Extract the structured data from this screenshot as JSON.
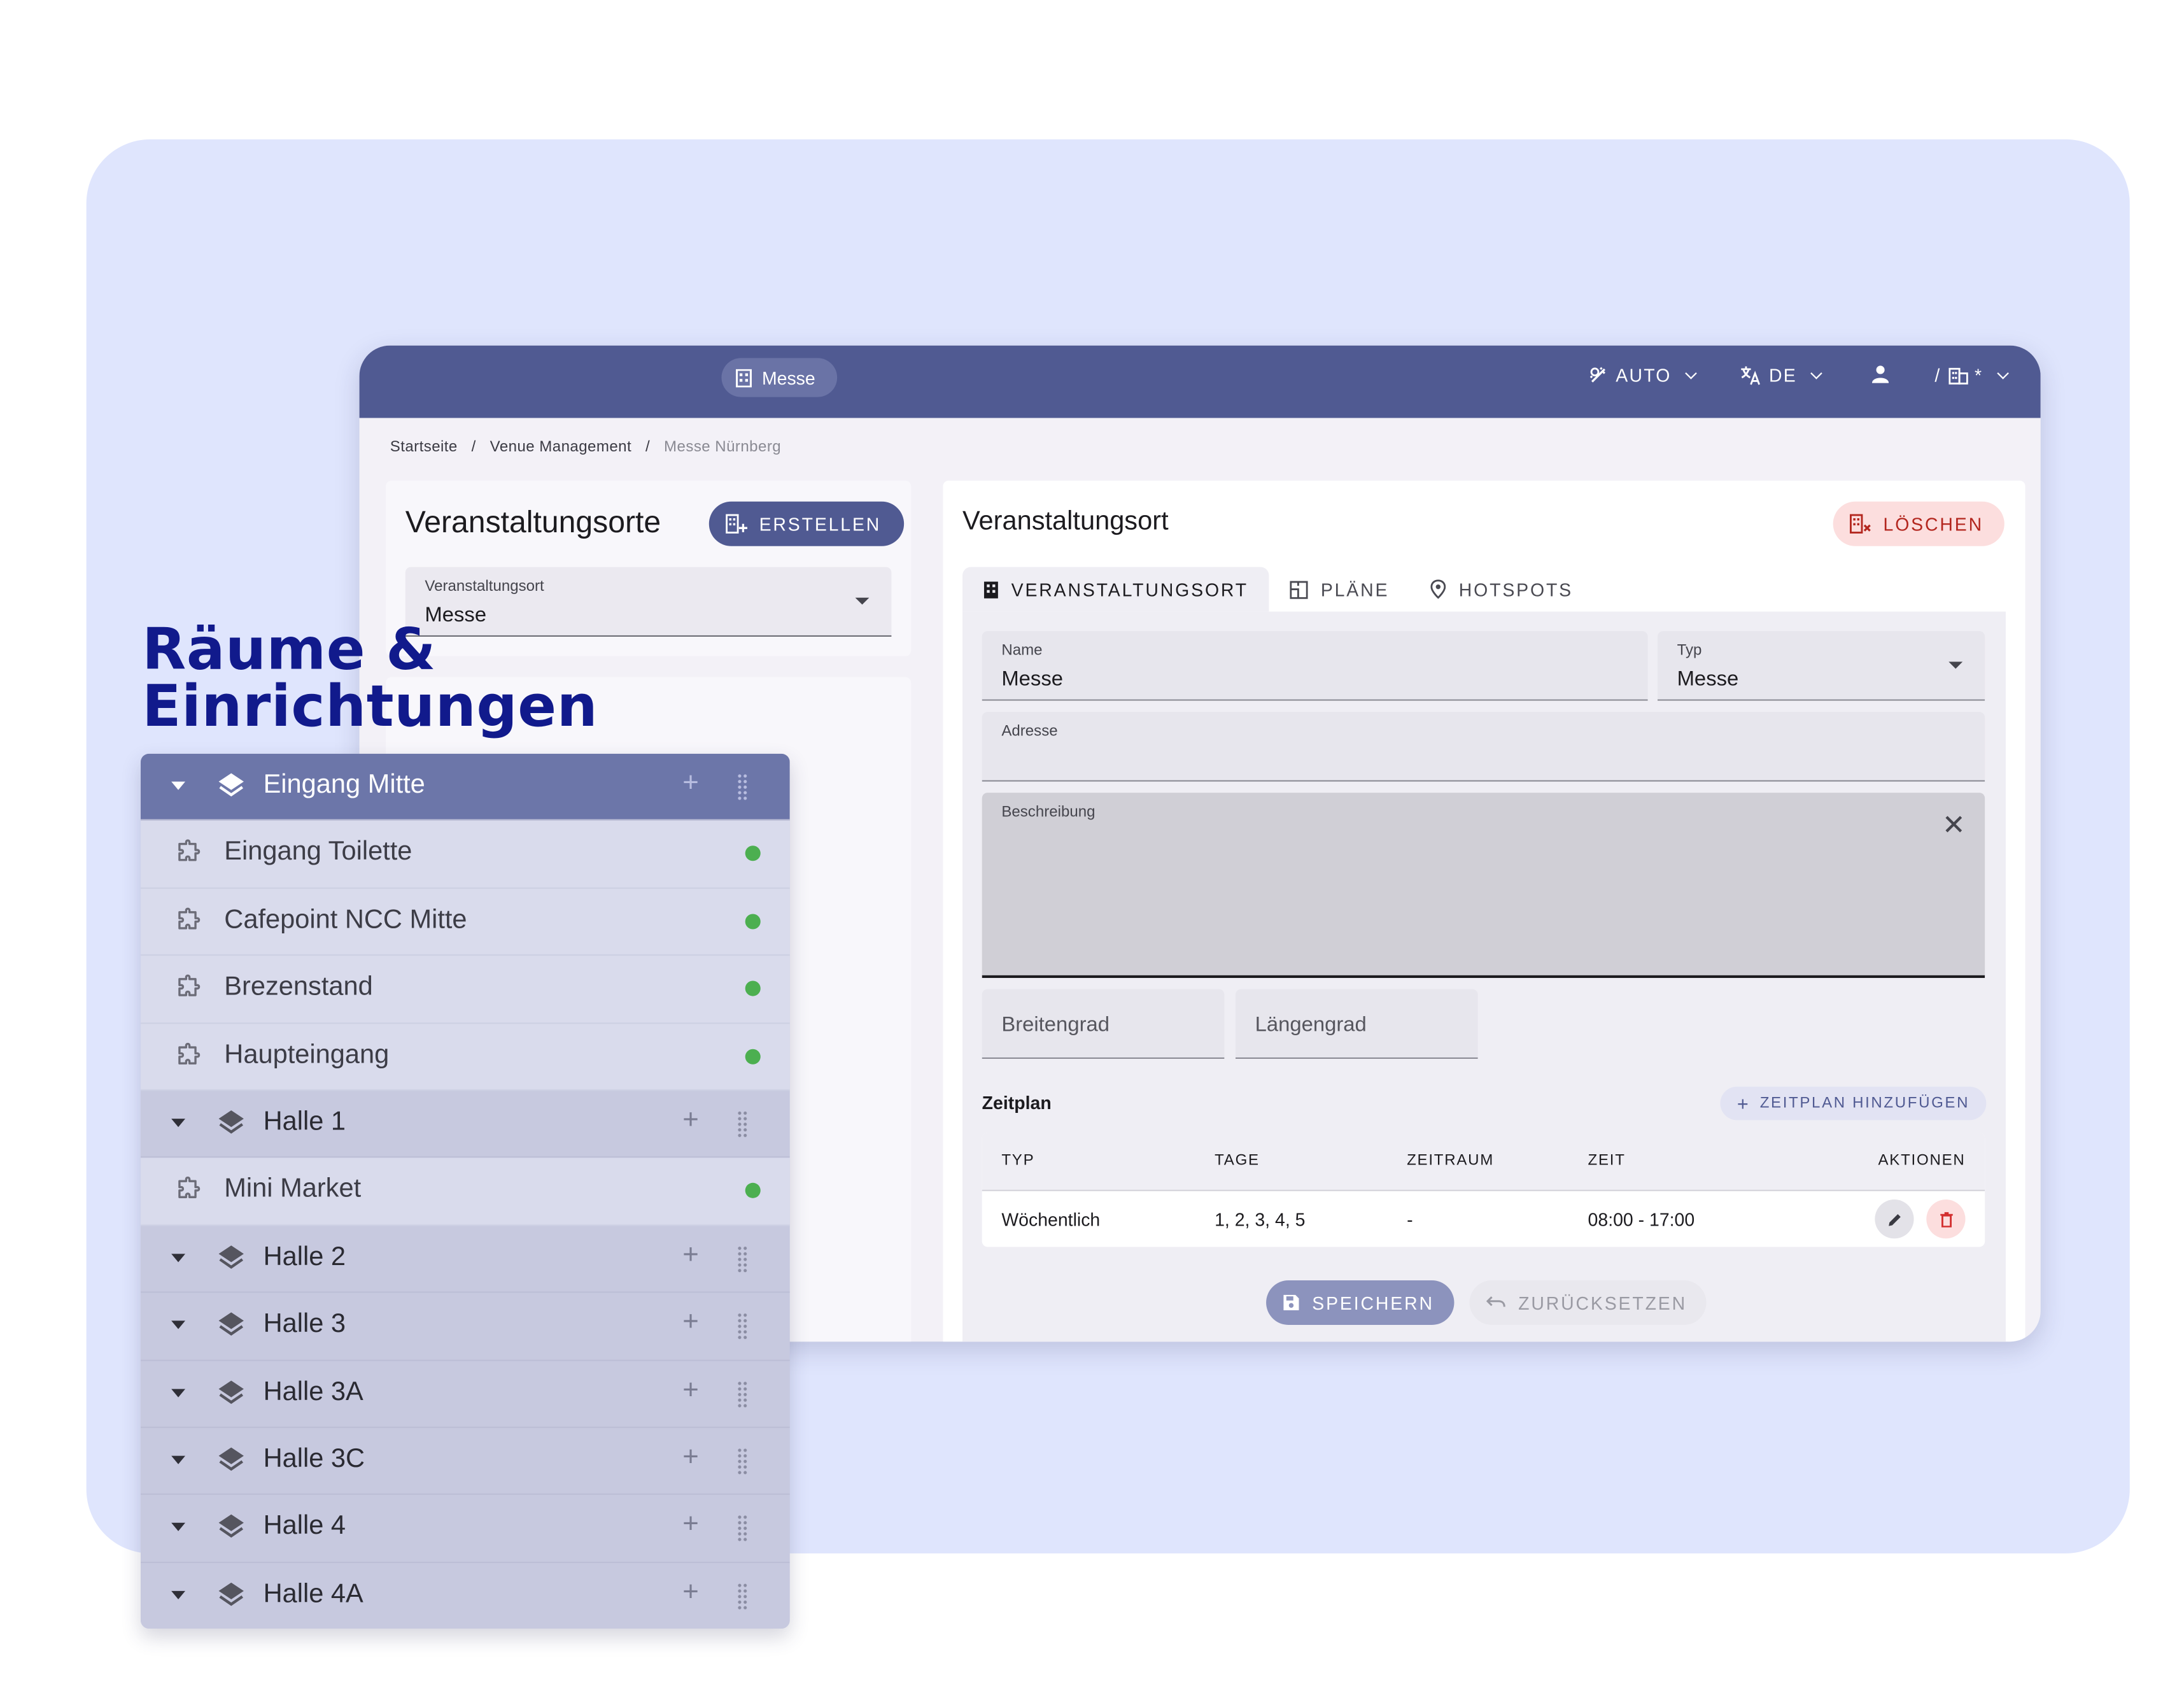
{
  "headline": {
    "line1": "Räume &",
    "line2": "Einrichtungen"
  },
  "topbar": {
    "venue_chip": "Messe",
    "theme": "AUTO",
    "language": "DE",
    "org_suffix": "*"
  },
  "breadcrumb": [
    "Startseite",
    "Venue Management",
    "Messe Nürnberg"
  ],
  "left_panel": {
    "title": "Veranstaltungsorte",
    "create_label": "ERSTELLEN",
    "select_label": "Veranstaltungsort",
    "select_value": "Messe"
  },
  "detail": {
    "title": "Veranstaltungsort",
    "delete_label": "LÖSCHEN",
    "tabs": [
      "VERANSTALTUNGSORT",
      "PLÄNE",
      "HOTSPOTS"
    ],
    "name_label": "Name",
    "name_value": "Messe",
    "type_label": "Typ",
    "type_value": "Messe",
    "address_label": "Adresse",
    "description_label": "Beschreibung",
    "lat_placeholder": "Breitengrad",
    "lng_placeholder": "Längengrad",
    "schedule_title": "Zeitplan",
    "add_schedule_label": "ZEITPLAN HINZUFÜGEN",
    "table": {
      "headers": [
        "TYP",
        "TAGE",
        "ZEITRAUM",
        "ZEIT",
        "AKTIONEN"
      ],
      "rows": [
        [
          "Wöchentlich",
          "1, 2, 3, 4, 5",
          "-",
          "08:00 - 17:00"
        ]
      ]
    },
    "save_label": "SPEICHERN",
    "reset_label": "ZURÜCKSETZEN"
  },
  "tree": {
    "groups": [
      {
        "name": "Eingang Mitte",
        "children": [
          "Eingang Toilette",
          "Cafepoint NCC Mitte",
          "Brezenstand",
          "Haupteingang"
        ]
      },
      {
        "name": "Halle 1",
        "children": [
          "Mini Market"
        ]
      },
      {
        "name": "Halle 2",
        "children": []
      },
      {
        "name": "Halle 3",
        "children": []
      },
      {
        "name": "Halle 3A",
        "children": []
      },
      {
        "name": "Halle 3C",
        "children": []
      },
      {
        "name": "Halle 4",
        "children": []
      },
      {
        "name": "Halle 4A",
        "children": []
      }
    ],
    "status_color": "#4caf50"
  },
  "colors": {
    "primary": "#505a92",
    "headline": "#111a8c",
    "danger": "#b3261e",
    "background_panel": "#dfe5fd"
  }
}
